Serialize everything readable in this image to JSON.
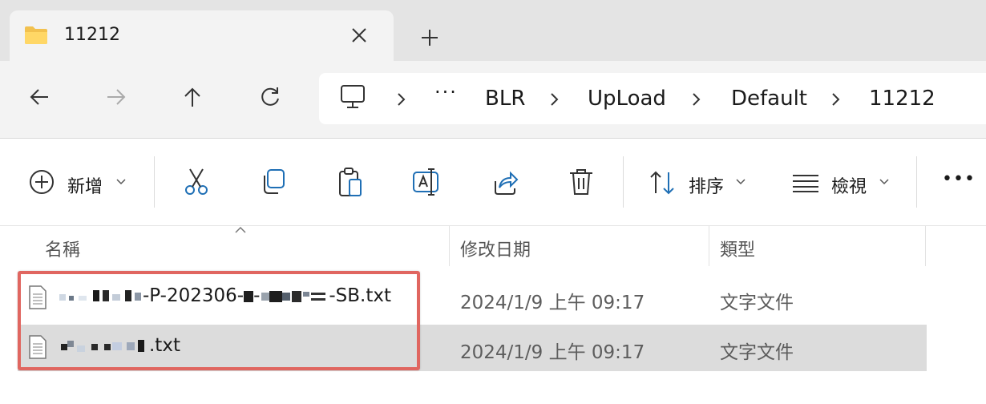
{
  "tab": {
    "title": "11212",
    "folder_icon": "folder-icon",
    "close_icon": "close-icon",
    "new_tab_icon": "plus-icon"
  },
  "nav": {
    "back_icon": "arrow-left-icon",
    "forward_icon": "arrow-right-icon",
    "up_icon": "arrow-up-icon",
    "refresh_icon": "refresh-icon",
    "breadcrumb": [
      "BLR",
      "UpLoad",
      "Default",
      "11212"
    ],
    "overflow": "···"
  },
  "commands": {
    "new_label": "新增",
    "sort_label": "排序",
    "view_label": "檢視",
    "more": "•••"
  },
  "columns": {
    "name": "名稱",
    "modified": "修改日期",
    "type": "類型"
  },
  "files": [
    {
      "name_visible": "-P-202306-",
      "name_mid": "-",
      "name_end": "-SB.txt",
      "modified": "2024/1/9 上午 09:17",
      "type": "文字文件"
    },
    {
      "name_end": ".txt",
      "modified": "2024/1/9 上午 09:17",
      "type": "文字文件"
    }
  ],
  "colors": {
    "selected_row": "#dcdcdc",
    "highlight": "#e06660",
    "tabstrip": "#e4e4e4"
  }
}
